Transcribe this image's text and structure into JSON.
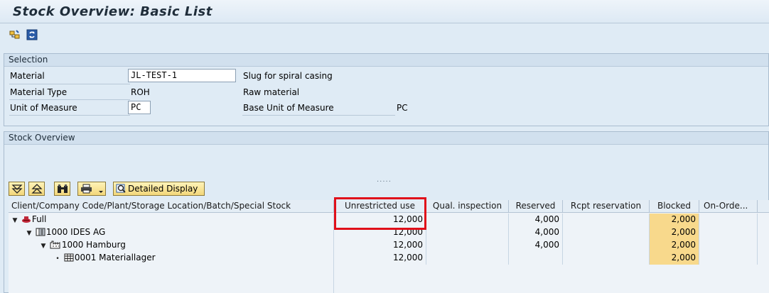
{
  "window": {
    "title": "Stock Overview: Basic List"
  },
  "appbar": {
    "icons": [
      "hierarchy-icon",
      "refresh-icon"
    ]
  },
  "selection": {
    "title": "Selection",
    "material_label": "Material",
    "material_value": "JL-TEST-1",
    "material_desc": "Slug for spiral casing",
    "material_type_label": "Material Type",
    "material_type_value": "ROH",
    "material_type_desc": "Raw material",
    "uom_label": "Unit of Measure",
    "uom_value": "PC",
    "base_uom_label": "Base Unit of Measure",
    "base_uom_value": "PC"
  },
  "stock": {
    "title": "Stock Overview",
    "resize_handle": ".....",
    "toolbar": {
      "detailed_display": "Detailed Display"
    },
    "columns": [
      "Client/Company Code/Plant/Storage Location/Batch/Special Stock",
      "Unrestricted use",
      "Qual. inspection",
      "Reserved",
      "Rcpt reservation",
      "Blocked",
      "On-Orde..."
    ],
    "rows": [
      {
        "label": "Full",
        "unrestricted": "12,000",
        "qual": "",
        "reserved": "4,000",
        "rcpt": "",
        "blocked": "2,000",
        "onorder": ""
      },
      {
        "label": "1000 IDES AG",
        "unrestricted": "12,000",
        "qual": "",
        "reserved": "4,000",
        "rcpt": "",
        "blocked": "2,000",
        "onorder": ""
      },
      {
        "label": "1000 Hamburg",
        "unrestricted": "12,000",
        "qual": "",
        "reserved": "4,000",
        "rcpt": "",
        "blocked": "2,000",
        "onorder": ""
      },
      {
        "label": "0001 Materiallager",
        "unrestricted": "12,000",
        "qual": "",
        "reserved": "",
        "rcpt": "",
        "blocked": "2,000",
        "onorder": ""
      }
    ]
  },
  "colors": {
    "highlight": "#e0101a",
    "blocked_bg": "#f8d98c",
    "background": "#dfebf5"
  }
}
